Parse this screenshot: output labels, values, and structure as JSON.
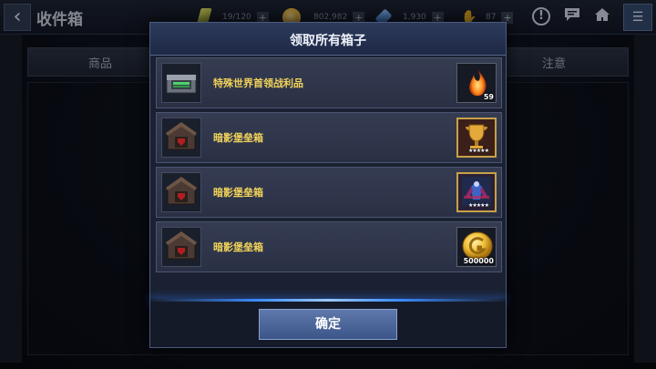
{
  "header": {
    "back_icon": "chevron-left-icon",
    "title": "收件箱",
    "resources": [
      {
        "icon": "energy-icon",
        "value": "19/120",
        "color": "#c7d24a"
      },
      {
        "icon": "gold-coin-icon",
        "value": "802,982",
        "color": "#e2b838"
      },
      {
        "icon": "crystal-icon",
        "value": "1,930",
        "color": "#4a8fe0"
      },
      {
        "icon": "hand-icon",
        "value": "87",
        "color": "#b9c2d4"
      }
    ],
    "actions": [
      "alert-icon",
      "chat-icon",
      "home-icon",
      "mail-menu-icon"
    ]
  },
  "background": {
    "columns": [
      "商品",
      "注意"
    ]
  },
  "modal": {
    "title": "领取所有箱子",
    "confirm_label": "确定",
    "rows": [
      {
        "label": "特殊世界首领战利品",
        "box_icon": "supply-crate-icon",
        "reward_icon": "fire-orb-icon",
        "reward_count": "59"
      },
      {
        "label": "暗影堡垒箱",
        "box_icon": "shadow-fortress-chest-icon",
        "reward_icon": "gold-trophy-icon",
        "reward_stars": "★★★★★"
      },
      {
        "label": "暗影堡垒箱",
        "box_icon": "shadow-fortress-chest-icon",
        "reward_icon": "hero-card-icon",
        "reward_stars": "★★★★★"
      },
      {
        "label": "暗影堡垒箱",
        "box_icon": "shadow-fortress-chest-icon",
        "reward_icon": "gold-coin-icon",
        "reward_count": "500000"
      }
    ]
  }
}
